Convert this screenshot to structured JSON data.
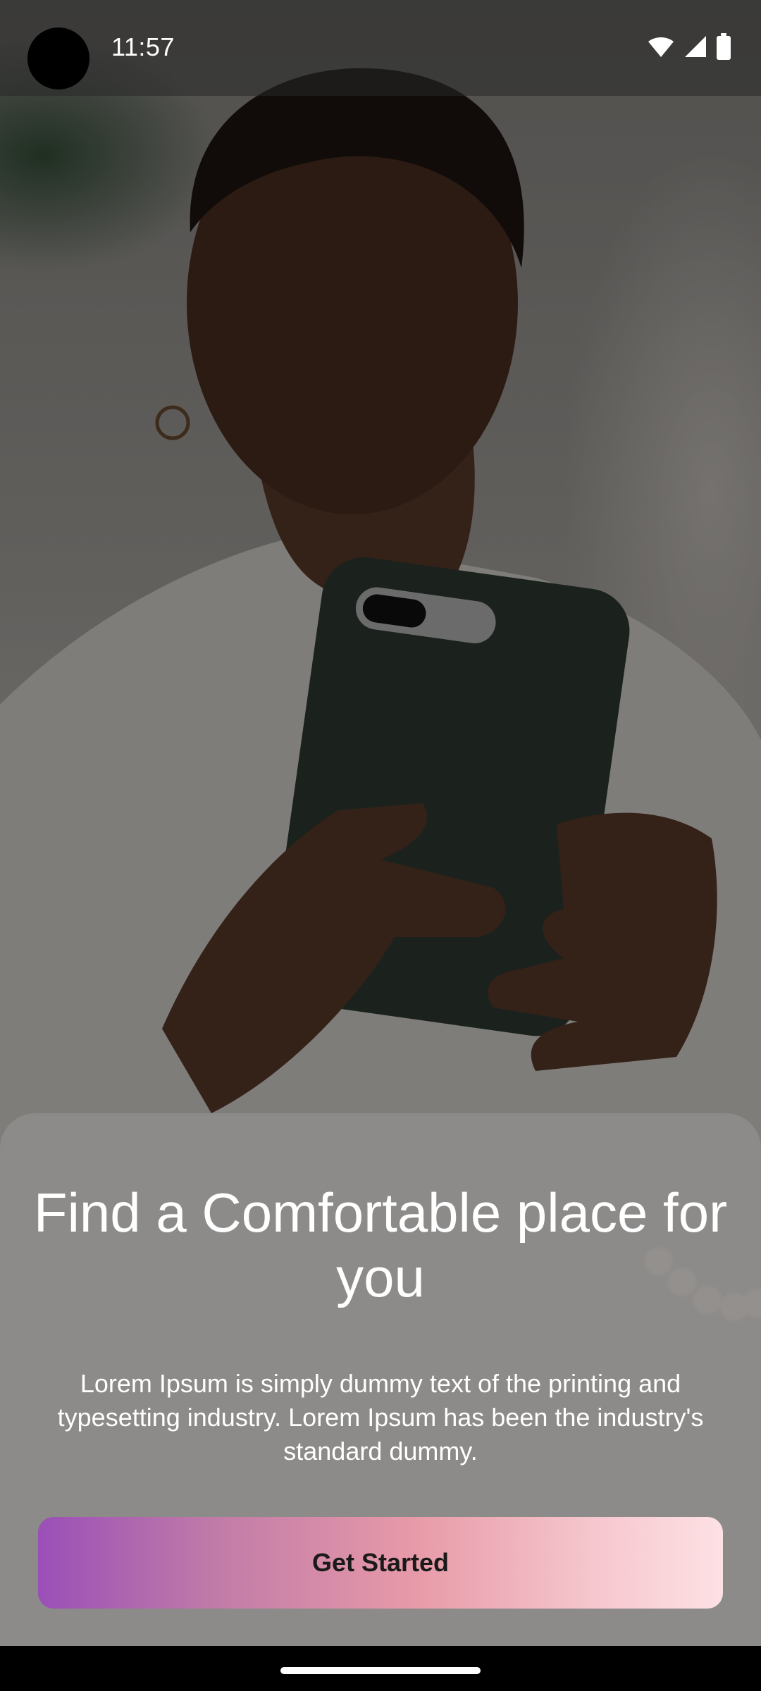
{
  "status_bar": {
    "time": "11:57",
    "icons": [
      "wifi-icon",
      "signal-icon",
      "battery-icon"
    ]
  },
  "background": {
    "image": "woman-holding-smartphone-photo"
  },
  "onboarding": {
    "title": "Find a Comfortable place for you",
    "description": "Lorem Ipsum is simply dummy text of the printing and typesetting industry. Lorem Ipsum has been the industry's standard dummy.",
    "cta_label": "Get Started"
  },
  "colors": {
    "cta_gradient_start": "#9a4fb8",
    "cta_gradient_end": "#fde1e4",
    "text": "#ffffff"
  }
}
